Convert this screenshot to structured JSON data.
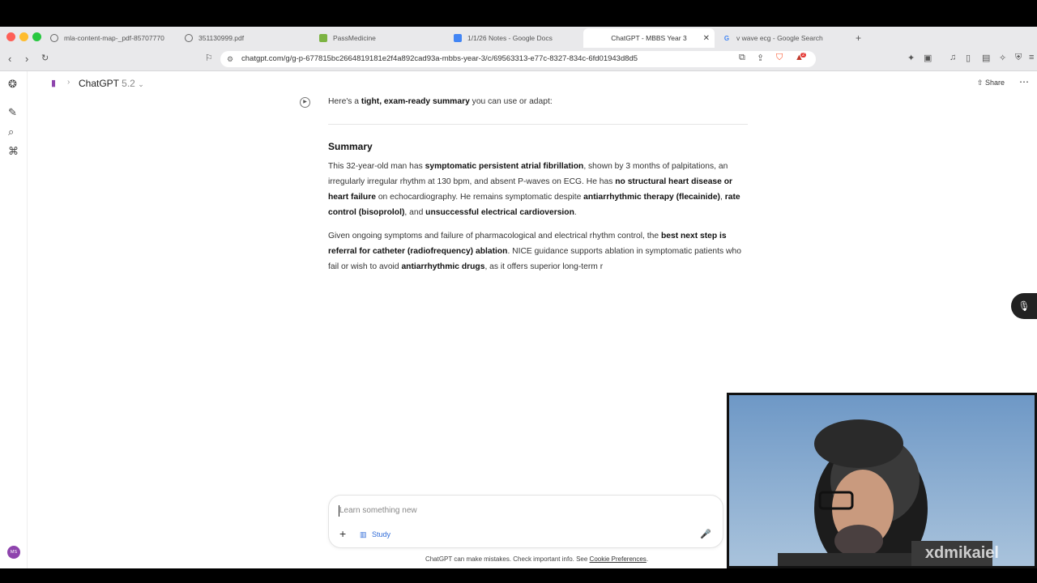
{
  "browser": {
    "tabs": [
      {
        "label": "mla-content-map-_pdf-85707770",
        "active": false
      },
      {
        "label": "351130999.pdf",
        "active": false
      },
      {
        "label": "PassMedicine",
        "active": false
      },
      {
        "label": "1/1/26 Notes - Google Docs",
        "active": false
      },
      {
        "label": "ChatGPT - MBBS Year 3",
        "active": true
      },
      {
        "label": "v wave ecg - Google Search",
        "active": false
      }
    ],
    "url": "chatgpt.com/g/g-p-677815bc2664819181e2f4a892cad93a-mbbs-year-3/c/69563313-e77c-8327-834c-6fd01943d8d5",
    "shield_badge": "2"
  },
  "header": {
    "app_name": "ChatGPT",
    "model_version": "5.2",
    "share_label": "Share"
  },
  "message": {
    "lead_prefix": "Here's a ",
    "lead_bold": "tight, exam-ready summary",
    "lead_suffix": " you can use or adapt:",
    "heading": "Summary",
    "p1": {
      "t1": "This 32-year-old man has ",
      "b1": "symptomatic persistent atrial fibrillation",
      "t2": ", shown by 3 months of palpitations, an irregularly irregular rhythm at 130 bpm, and absent P-waves on ECG. He has ",
      "b2": "no structural heart disease or heart failure",
      "t3": " on echocardiography. He remains symptomatic despite ",
      "b3": "antiarrhythmic therapy (flecainide)",
      "t4": ", ",
      "b4": "rate control (bisoprolol)",
      "t5": ", and ",
      "b5": "unsuccessful electrical cardioversion",
      "t6": "."
    },
    "p2": {
      "t1": "Given ongoing symptoms and failure of pharmacological and electrical rhythm control, the ",
      "b1": "best next step is referral for catheter (radiofrequency) ablation",
      "t2": ". NICE guidance supports ablation in symptomatic patients who fail or wish to avoid ",
      "b2": "antiarrhythmic drugs",
      "t3": ", as it offers superior long-term r"
    }
  },
  "composer": {
    "placeholder": "Learn something new",
    "study_label": "Study"
  },
  "footer": {
    "disclaimer_prefix": "ChatGPT can make mistakes. Check important info. See ",
    "link": "Cookie Preferences",
    "disclaimer_suffix": "."
  },
  "sidebar": {
    "avatar_initials": "MS"
  },
  "webcam": {
    "watermark": "xdmikaiel"
  },
  "colors": {
    "accent_blue": "#2f6bd8",
    "avatar": "#8e44ad",
    "brave_orange": "#fb542b"
  }
}
